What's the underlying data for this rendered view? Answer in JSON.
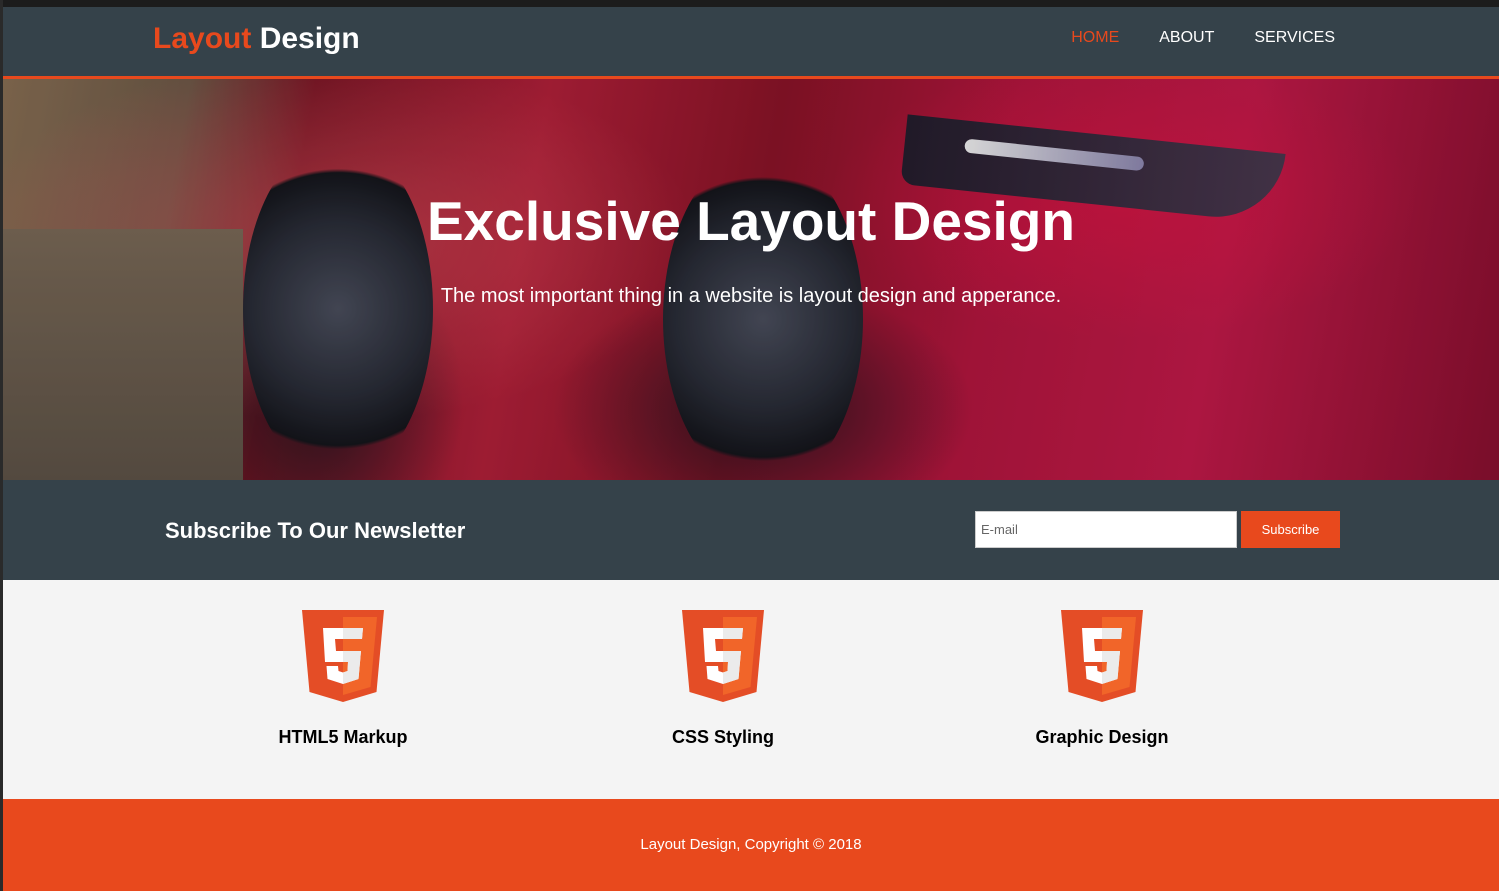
{
  "header": {
    "brand_highlight": "Layout",
    "brand_rest": "Design",
    "nav": [
      {
        "label": "HOME",
        "active": true
      },
      {
        "label": "ABOUT",
        "active": false
      },
      {
        "label": "SERVICES",
        "active": false
      }
    ]
  },
  "hero": {
    "title": "Exclusive Layout Design",
    "subtitle": "The most important thing in a website is layout design and apperance."
  },
  "newsletter": {
    "heading": "Subscribe To Our Newsletter",
    "email_placeholder": "E-mail",
    "email_value": "",
    "button_label": "Subscribe"
  },
  "features": [
    {
      "icon": "html5-icon",
      "title": "HTML5 Markup"
    },
    {
      "icon": "html5-icon",
      "title": "CSS Styling"
    },
    {
      "icon": "html5-icon",
      "title": "Graphic Design"
    }
  ],
  "footer": {
    "text": "Layout Design, Copyright © 2018"
  },
  "colors": {
    "accent": "#e8491d",
    "dark": "#35424a",
    "light_bg": "#f4f4f4",
    "html5_orange": "#e44d26",
    "html5_light_orange": "#f16529"
  }
}
